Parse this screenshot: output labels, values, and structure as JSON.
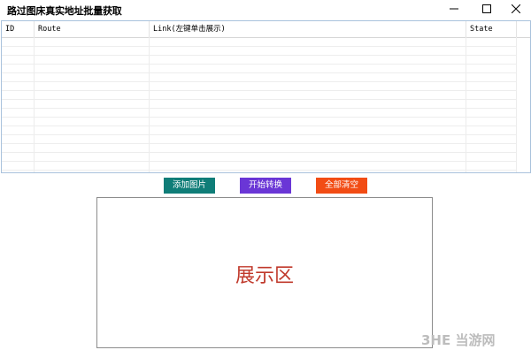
{
  "window": {
    "title": "路过图床真实地址批量获取"
  },
  "grid": {
    "columns": [
      {
        "label": "ID"
      },
      {
        "label": "Route"
      },
      {
        "label": "Link(左键单击展示)"
      },
      {
        "label": "State"
      }
    ],
    "rows": []
  },
  "buttons": {
    "add_images": {
      "label": "添加图片",
      "color": "#0f7d78"
    },
    "start_convert": {
      "label": "开始转换",
      "color": "#6a36d6"
    },
    "clear_all": {
      "label": "全部清空",
      "color": "#f24c14"
    }
  },
  "display": {
    "label": "展示区",
    "text_color": "#c0392b"
  },
  "watermark": {
    "text": "3HE 当游网"
  }
}
